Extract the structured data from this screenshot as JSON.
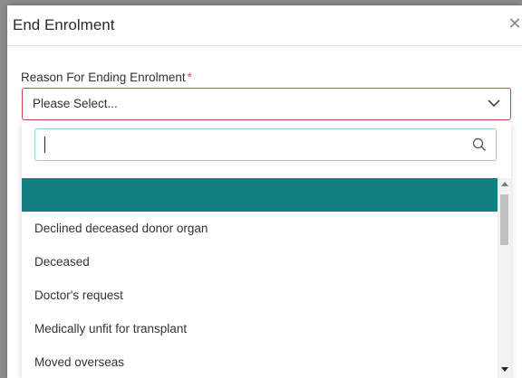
{
  "modal": {
    "title": "End Enrolment",
    "close_icon": "close-icon"
  },
  "field": {
    "label": "Reason For Ending Enrolment",
    "required_marker": "*",
    "selected_value": "Please Select...",
    "chevron_icon": "chevron-down-icon"
  },
  "dropdown": {
    "search_value": "",
    "search_icon": "search-icon",
    "options": [
      {
        "label": "",
        "highlighted": true
      },
      {
        "label": "Declined deceased donor organ",
        "highlighted": false
      },
      {
        "label": "Deceased",
        "highlighted": false
      },
      {
        "label": "Doctor's request",
        "highlighted": false
      },
      {
        "label": "Medically unfit for transplant",
        "highlighted": false
      },
      {
        "label": "Moved overseas",
        "highlighted": false
      }
    ]
  },
  "colors": {
    "highlight": "#137f80",
    "required": "#d9534f",
    "invalid_border": "#c9434b",
    "search_focus_border": "#8fcfd0"
  }
}
